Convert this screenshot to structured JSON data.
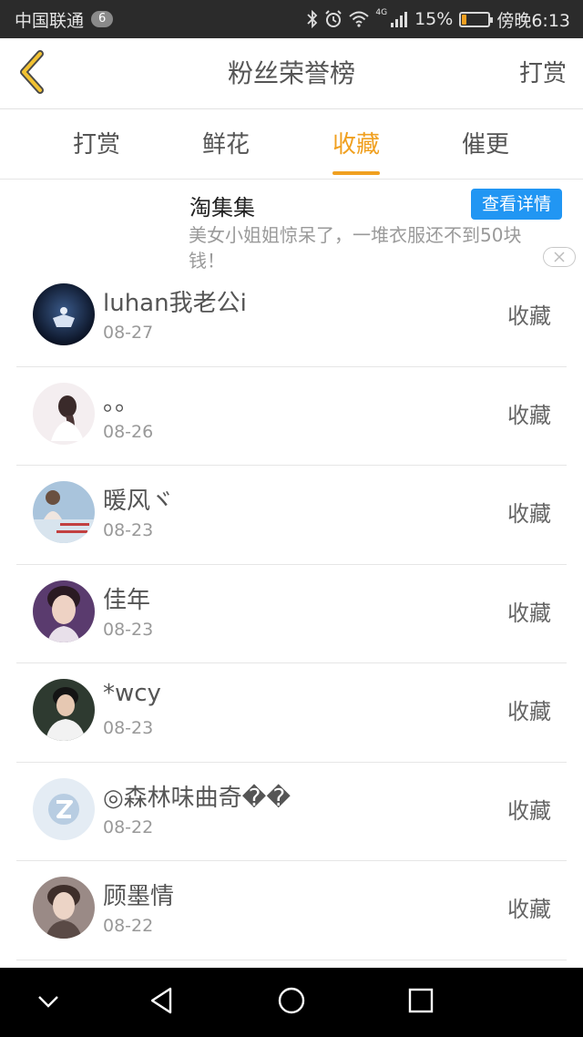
{
  "status_bar": {
    "carrier": "中国联通",
    "notification_count": "6",
    "battery_text": "15%",
    "battery_level": 0.15,
    "clock": "傍晚6:13",
    "network_label": "4G"
  },
  "header": {
    "title": "粉丝荣誉榜",
    "right_action": "打赏"
  },
  "tabs": [
    {
      "label": "打赏",
      "active": false
    },
    {
      "label": "鲜花",
      "active": false
    },
    {
      "label": "收藏",
      "active": true
    },
    {
      "label": "催更",
      "active": false
    }
  ],
  "ad": {
    "title": "淘集集",
    "button": "查看详情",
    "description": "美女小姐姐惊呆了，一堆衣服还不到50块钱！"
  },
  "fans": [
    {
      "name": "luhan我老公i",
      "date": "08-27",
      "action": "收藏"
    },
    {
      "name": "。。",
      "date": "08-26",
      "action": "收藏"
    },
    {
      "name": "暖风ヾ",
      "date": "08-23",
      "action": "收藏"
    },
    {
      "name": "佳年",
      "date": "08-23",
      "action": "收藏"
    },
    {
      "name": "*wcy",
      "date": "08-23",
      "action": "收藏"
    },
    {
      "name": "◎森林味曲奇��",
      "date": "08-22",
      "action": "收藏"
    },
    {
      "name": "顾墨情",
      "date": "08-22",
      "action": "收藏"
    }
  ],
  "colors": {
    "accent": "#f0a020",
    "ad_button": "#2196f3",
    "status_bar": "#2b2b2b"
  }
}
